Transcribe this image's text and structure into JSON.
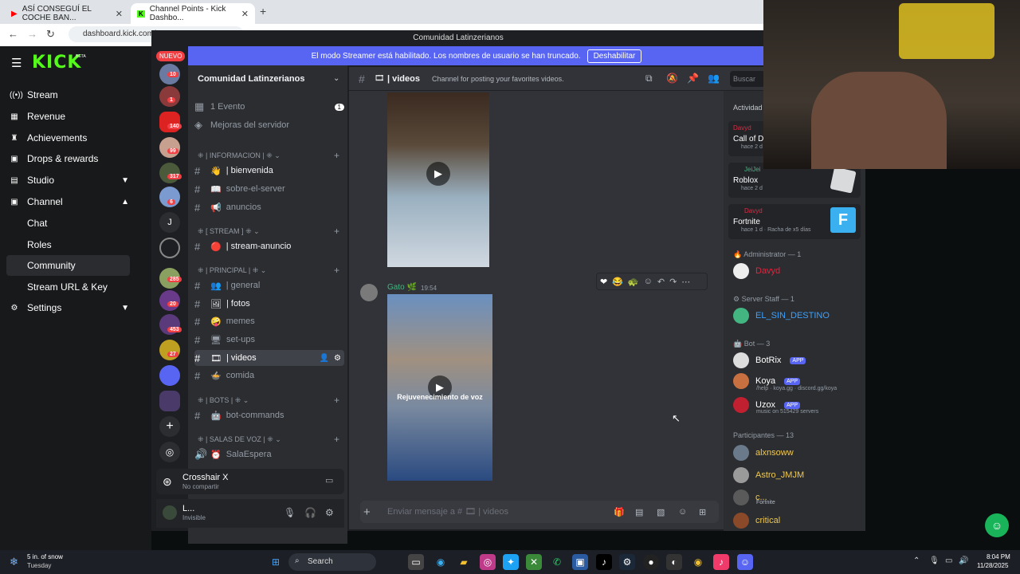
{
  "browser": {
    "tab1_title": "ASÍ CONSEGUÍ EL COCHE BAN...",
    "tab2_title": "Channel Points - Kick Dashbo...",
    "url": "dashboard.kick.com/"
  },
  "kick": {
    "logo": "KICK",
    "beta": "BETA",
    "nav": [
      "Stream",
      "Revenue",
      "Achievements",
      "Drops & rewards",
      "Studio",
      "Channel"
    ],
    "channel_sub": [
      "Chat",
      "Roles",
      "Community",
      "Stream URL & Key"
    ],
    "settings": "Settings"
  },
  "discord": {
    "window_title": "Comunidad Latinzerianos",
    "banner_text": "El modo Streamer está habilitado. Los nombres de usuario se han truncado.",
    "banner_button": "Deshabilitar",
    "nuevo": "NUEVO",
    "server_name": "Comunidad Latinzerianos",
    "events": "1 Evento",
    "events_count": "1",
    "boosts": "Mejoras del servidor",
    "server_badges": [
      "10",
      "1",
      "140",
      "99",
      "317",
      "6",
      "285",
      "20",
      "453",
      "27"
    ],
    "server_letter": "J",
    "categories": {
      "info": "| INFORMACION |",
      "stream": "[ STREAM ]",
      "principal": "| PRINCIPAL |",
      "bots": "| BOTS |",
      "voz": "| SALAS DE VOZ |"
    },
    "channels": {
      "bienvenida": "| bienvenida",
      "sobre": "sobre-el-server",
      "anuncios": "anuncios",
      "stream_anuncio": "| stream-anuncio",
      "general": "| general",
      "fotos": "| fotos",
      "memes": "memes",
      "setups": "set-ups",
      "videos": "| videos",
      "comida": "comida",
      "bot_commands": "bot-commands",
      "sala_espera": "SalaEspera"
    },
    "crosshair_name": "Crosshair X",
    "crosshair_sub": "No compartir",
    "user_name": "L...",
    "user_status": "Invisible",
    "chat_channel": "| videos",
    "chat_topic": "Channel for posting your favorites videos.",
    "search_placeholder": "Buscar",
    "msg_author": "Gato 🌿",
    "msg_time": "19:54",
    "video2_caption": "Rejuvenecimiento de voz",
    "input_placeholder": "Enviar mensaje a # 🎞 | videos",
    "activity_header": "Actividad",
    "activities": [
      {
        "user": "Davyd",
        "game": "Call of Du",
        "sub": "hace 2 d"
      },
      {
        "user": "JeiJei",
        "game": "Roblox",
        "sub": "hace 2 d"
      },
      {
        "user": "Davyd",
        "game": "Fortnite",
        "sub": "hace 1 d · Racha de x5 días"
      }
    ],
    "roles": [
      {
        "header": "Administrator — 1",
        "members": [
          {
            "name": "Davyd",
            "color": "#e8233d"
          }
        ]
      },
      {
        "header": "Server Staff — 1",
        "members": [
          {
            "name": "EL_SIN_DESTINO",
            "color": "#3ba2ff"
          }
        ]
      },
      {
        "header": "Bot — 3",
        "members": [
          {
            "name": "BotRix",
            "color": "#ffffff",
            "sub": ""
          },
          {
            "name": "Koya",
            "color": "#ffffff",
            "sub": "/help · koya.gg · discord.gg/koya"
          },
          {
            "name": "Uzox",
            "color": "#ffffff",
            "sub": "music on 515429 servers"
          }
        ]
      },
      {
        "header": "Participantes — 13",
        "members": [
          {
            "name": "alxnsoww",
            "color": "#f0c850"
          },
          {
            "name": "Astro_JMJM",
            "color": "#f0c850"
          },
          {
            "name": "c...",
            "color": "#f0c850",
            "sub": "Fortnite"
          },
          {
            "name": "critical",
            "color": "#f0c850"
          }
        ]
      }
    ],
    "app_tag": "APP"
  },
  "taskbar": {
    "weather_top": "5 in. of snow",
    "weather_bottom": "Tuesday",
    "search": "Search",
    "time": "8:04 PM",
    "date": "11/28/2025"
  }
}
